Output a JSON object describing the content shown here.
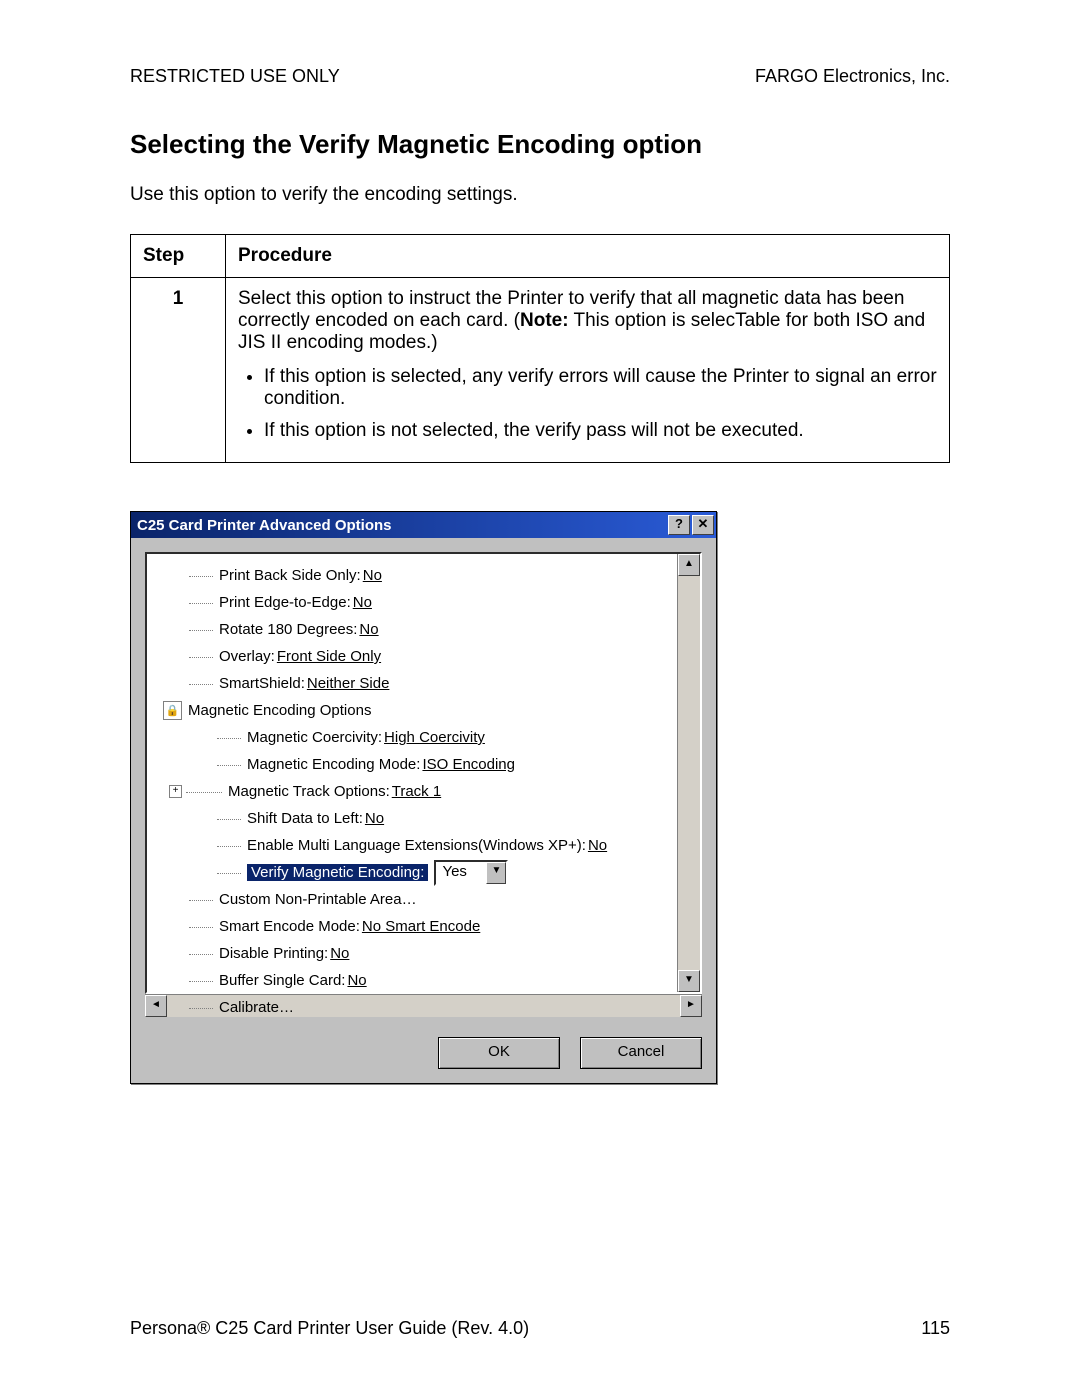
{
  "header": {
    "left": "RESTRICTED USE ONLY",
    "right": "FARGO Electronics, Inc."
  },
  "heading": "Selecting the Verify Magnetic Encoding option",
  "intro": "Use this option to verify the encoding settings.",
  "table": {
    "col1": "Step",
    "col2": "Procedure",
    "step_num": "1",
    "para1a": "Select this option to instruct the Printer to verify that all magnetic data has been correctly encoded on each card.  (",
    "note_label": "Note:",
    "para1b": "  This option is selecTable for both ISO and JIS II encoding modes.)",
    "bullet1": "If this option is selected, any verify errors will cause the Printer to signal an error condition.",
    "bullet2": "If this option is not selected, the verify pass will not be executed."
  },
  "dialog": {
    "title": "C25 Card Printer Advanced Options",
    "help": "?",
    "close": "✕",
    "scroll": {
      "up": "▲",
      "down": "▼",
      "left": "◄",
      "right": "►"
    },
    "items": {
      "print_back_label": "Print Back Side Only:",
      "print_back_val": "No",
      "edge_label": "Print Edge-to-Edge:",
      "edge_val": "No",
      "rotate_label": "Rotate 180 Degrees:",
      "rotate_val": "No",
      "overlay_label": "Overlay:",
      "overlay_val": "Front Side Only",
      "smartshield_label": "SmartShield:",
      "smartshield_val": "Neither Side",
      "mag_options": "Magnetic Encoding Options",
      "coerc_label": "Magnetic Coercivity:",
      "coerc_val": "High Coercivity",
      "mode_label": "Magnetic Encoding Mode:",
      "mode_val": "ISO Encoding",
      "track_plus": "+",
      "track_label": "Magnetic Track Options:",
      "track_val": "Track 1",
      "shift_label": "Shift Data to Left:",
      "shift_val": "No",
      "multi_label": "Enable Multi Language Extensions(Windows XP+):",
      "multi_val": "No",
      "verify_label": "Verify Magnetic Encoding:",
      "verify_val": "Yes",
      "custom_label": "Custom Non-Printable Area…",
      "smartenc_label": "Smart Encode Mode:",
      "smartenc_val": "No Smart Encode",
      "disable_label": "Disable Printing:",
      "disable_val": "No",
      "buffer_label": "Buffer Single Card:",
      "buffer_val": "No",
      "calibrate_label": "Calibrate…"
    },
    "dd_arrow": "▼",
    "ok": "OK",
    "cancel": "Cancel"
  },
  "footer": {
    "left": "Persona® C25 Card Printer User Guide (Rev. 4.0)",
    "right": "115"
  },
  "lock_glyph": "🔒"
}
